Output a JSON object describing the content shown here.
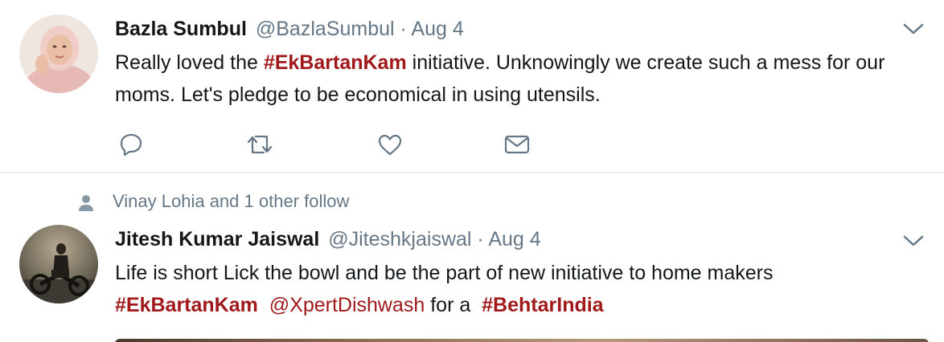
{
  "tweets": [
    {
      "name": "Bazla Sumbul",
      "handle": "@BazlaSumbul",
      "separator": "·",
      "date": "Aug 4",
      "text": {
        "part1": "Really loved the ",
        "hashtag1": "#EkBartanKam",
        "part2": " initiative. Unknowingly we create such a mess for our moms. Let's pledge to be economical in using utensils."
      },
      "actions": [
        "reply-icon",
        "retweet-icon",
        "like-icon",
        "direct-message-icon"
      ]
    },
    {
      "social_context": "Vinay Lohia and 1 other follow",
      "name": "Jitesh Kumar Jaiswal",
      "handle": "@Jiteshkjaiswal",
      "separator": "·",
      "date": "Aug 4",
      "text": {
        "line1": "Life is short Lick the bowl and be the part of new initiative to home makers",
        "hashtag1": "#EkBartanKam",
        "mention1": "@XpertDishwash",
        "part2": " for a ",
        "hashtag2": "#BehtarIndia"
      }
    }
  ],
  "colors": {
    "link": "#a0191a",
    "secondary": "#657786",
    "divider": "#e6ecf0"
  }
}
